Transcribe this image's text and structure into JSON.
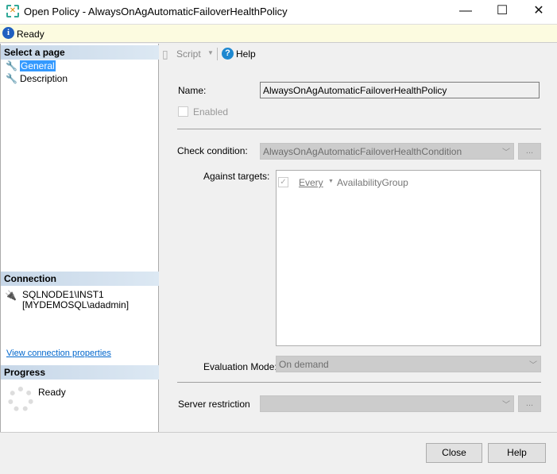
{
  "window": {
    "title": "Open Policy - AlwaysOnAgAutomaticFailoverHealthPolicy",
    "minimize": "—",
    "maximize": "☐",
    "close": "✕"
  },
  "status": {
    "text": "Ready"
  },
  "sidebar": {
    "select_page_header": "Select a page",
    "pages": [
      {
        "label": "General",
        "selected": true
      },
      {
        "label": "Description",
        "selected": false
      }
    ],
    "connection_header": "Connection",
    "server": "SQLNODE1\\INST1",
    "user": "[MYDEMOSQL\\adadmin]",
    "view_connection_link": "View connection properties",
    "progress_header": "Progress",
    "progress_status": "Ready"
  },
  "toolbar": {
    "script_label": "Script",
    "help_label": "Help"
  },
  "form": {
    "name_label": "Name:",
    "name_value": "AlwaysOnAgAutomaticFailoverHealthPolicy",
    "enabled_label": "Enabled",
    "check_condition_label": "Check condition:",
    "check_condition_value": "AlwaysOnAgAutomaticFailoverHealthCondition",
    "ellipsis": "...",
    "against_targets_label": "Against targets:",
    "target_every": "Every",
    "target_type": "AvailabilityGroup",
    "evaluation_mode_label": "Evaluation Mode:",
    "evaluation_mode_value": "On demand",
    "server_restriction_label": "Server restriction",
    "server_restriction_value": ""
  },
  "footer": {
    "close_label": "Close",
    "help_label": "Help"
  }
}
